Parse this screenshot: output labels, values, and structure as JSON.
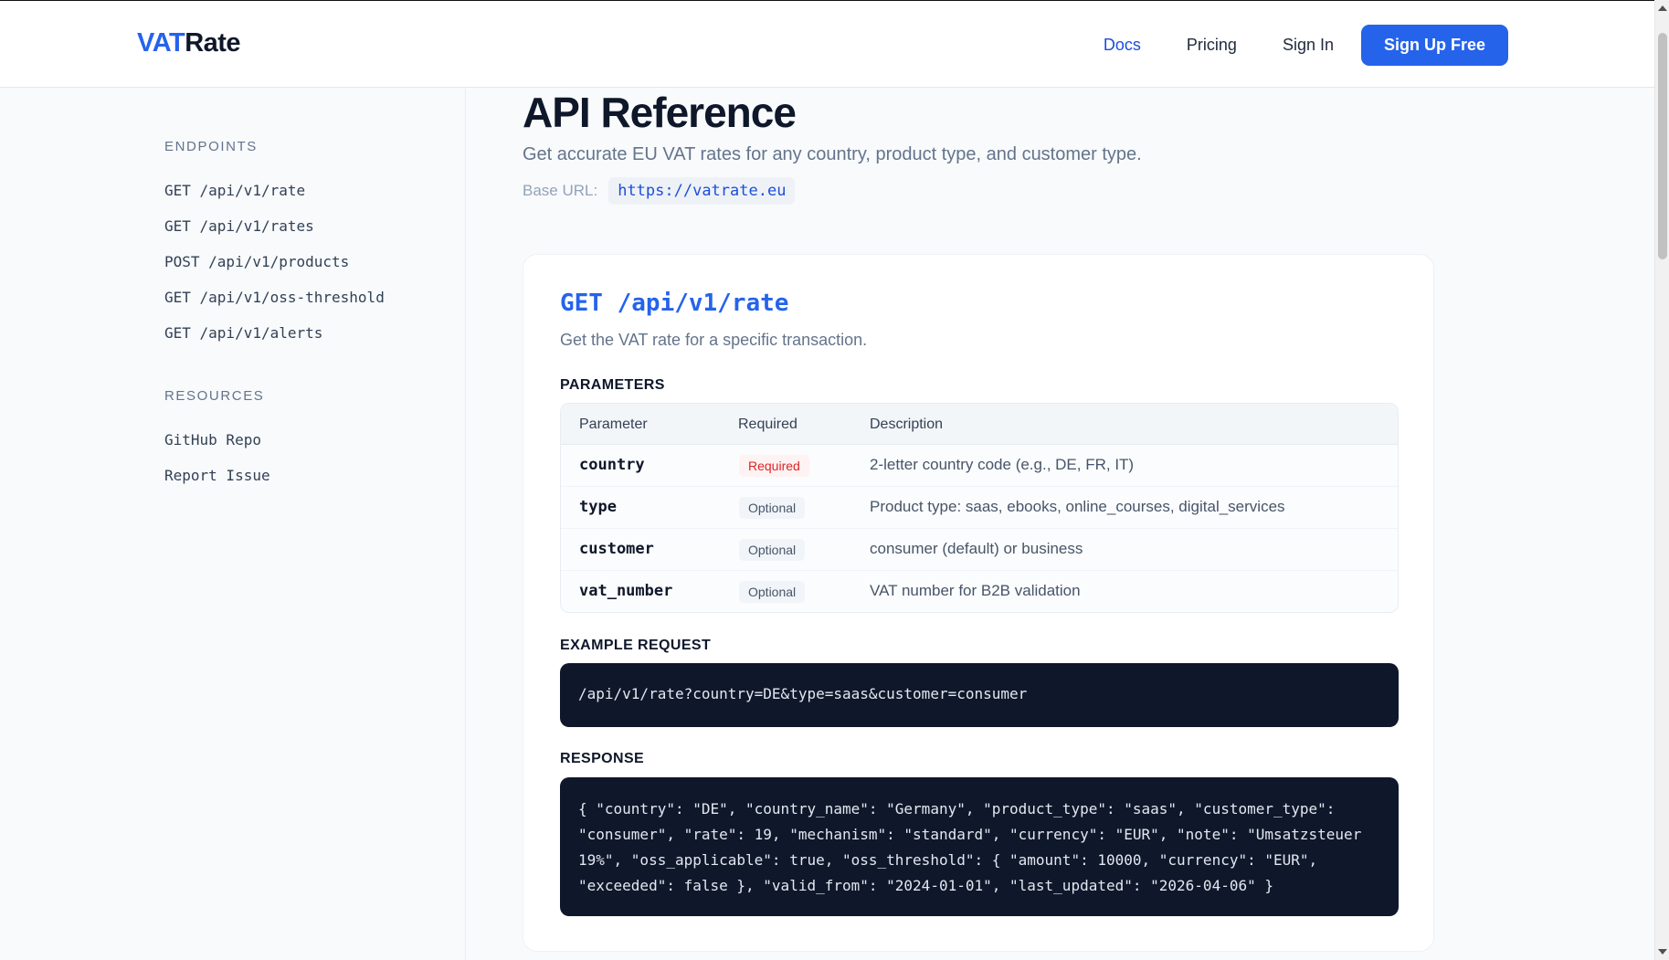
{
  "header": {
    "logo_part1": "VAT",
    "logo_part2": "Rate",
    "nav": {
      "docs": "Docs",
      "pricing": "Pricing",
      "sign_in": "Sign In",
      "sign_up": "Sign Up Free"
    }
  },
  "sidebar": {
    "endpoints_heading": "ENDPOINTS",
    "endpoints": [
      "GET /api/v1/rate",
      "GET /api/v1/rates",
      "POST /api/v1/products",
      "GET /api/v1/oss-threshold",
      "GET /api/v1/alerts"
    ],
    "resources_heading": "RESOURCES",
    "resources": [
      "GitHub Repo",
      "Report Issue"
    ]
  },
  "main": {
    "title": "API Reference",
    "lead": "Get accurate EU VAT rates for any country, product type, and customer type.",
    "base_url_label": "Base URL:",
    "base_url": "https://vatrate.eu"
  },
  "endpoint": {
    "title": "GET /api/v1/rate",
    "description": "Get the VAT rate for a specific transaction.",
    "params_heading": "PARAMETERS",
    "columns": [
      "Parameter",
      "Required",
      "Description"
    ],
    "params": [
      {
        "name": "country",
        "required": "Required",
        "description": "2-letter country code (e.g., DE, FR, IT)"
      },
      {
        "name": "type",
        "required": "Optional",
        "description": "Product type: saas, ebooks, online_courses, digital_services"
      },
      {
        "name": "customer",
        "required": "Optional",
        "description": "consumer (default) or business"
      },
      {
        "name": "vat_number",
        "required": "Optional",
        "description": "VAT number for B2B validation"
      }
    ],
    "example_heading": "EXAMPLE REQUEST",
    "example_request": "/api/v1/rate?country=DE&type=saas&customer=consumer",
    "response_heading": "RESPONSE",
    "response": "{ \"country\": \"DE\", \"country_name\": \"Germany\", \"product_type\": \"saas\", \"customer_type\": \"consumer\", \"rate\": 19, \"mechanism\": \"standard\", \"currency\": \"EUR\", \"note\": \"Umsatzsteuer 19%\", \"oss_applicable\": true, \"oss_threshold\": { \"amount\": 10000, \"currency\": \"EUR\", \"exceeded\": false }, \"valid_from\": \"2024-01-01\", \"last_updated\": \"2026-04-06\" }"
  },
  "colors": {
    "accent": "#2563eb",
    "code_bg": "#0f172a",
    "required": "#dc2626"
  }
}
